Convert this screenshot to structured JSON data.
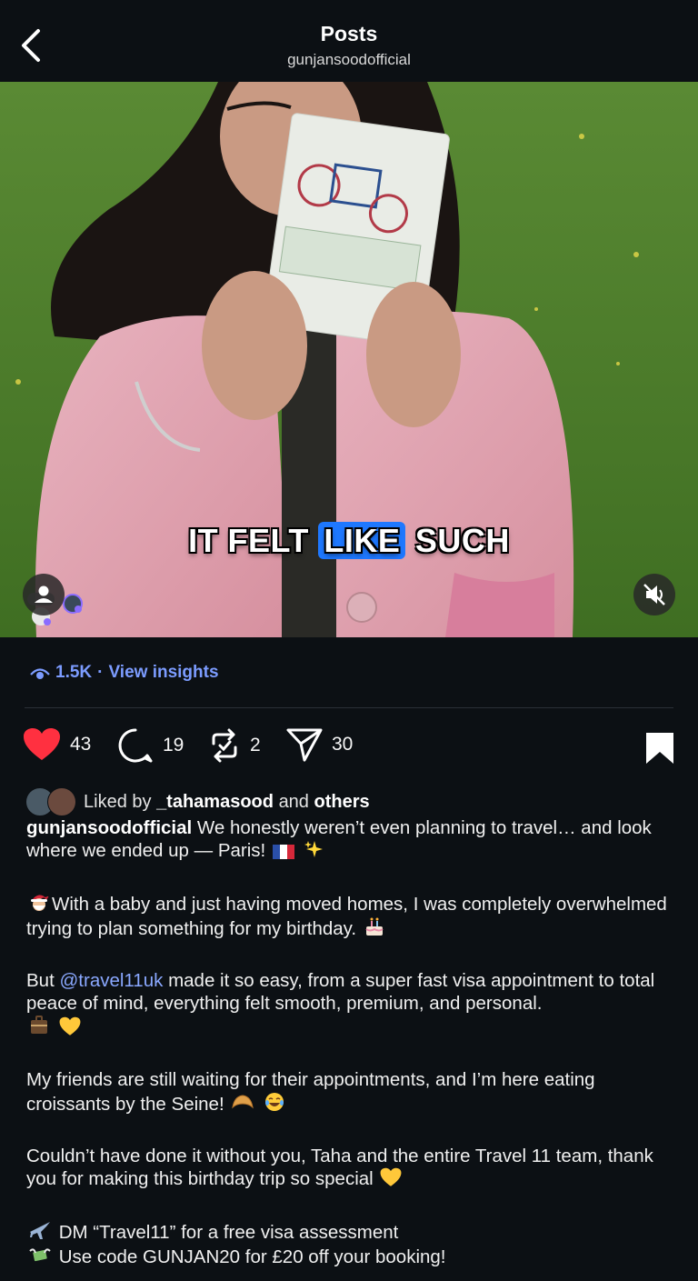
{
  "header": {
    "title": "Posts",
    "username": "gunjansoodofficial"
  },
  "media": {
    "overlay_caption_before": "IT FELT",
    "overlay_caption_highlight": "LIKE",
    "overlay_caption_after": "SUCH",
    "muted": true
  },
  "insights": {
    "views": "1.5K",
    "separator": "·",
    "link": "View insights"
  },
  "actions": {
    "likes": "43",
    "comments": "19",
    "reposts": "2",
    "shares": "30",
    "liked": true,
    "saved": true
  },
  "liked_by": {
    "prefix": "Liked by",
    "user": "_tahamasood",
    "middle": "and",
    "suffix": "others"
  },
  "caption": {
    "username": "gunjansoodofficial",
    "p1": "We honestly weren’t even planning to travel… and look where we ended up — Paris!",
    "p2": "With a baby and just having moved homes, I was completely overwhelmed trying to plan something for my birthday.",
    "p3_before": "But",
    "p3_mention": "@travel11uk",
    "p3_after": "made it so easy, from a super fast visa appointment to total peace of mind, everything felt smooth, premium, and personal.",
    "p4": "My friends are still waiting for their appointments, and I’m here eating croissants by the Seine!",
    "p5": "Couldn’t have done it without you, Taha and the entire Travel 11 team, thank you for making this birthday trip so special",
    "p6a": "DM “Travel11” for a free visa assessment",
    "p6b": "Use code GUNJAN20 for £20 off your booking!"
  },
  "colors": {
    "background": "#0c1014",
    "like_red": "#ff3040",
    "link_blue": "#7c9cff",
    "highlight_blue": "#1e78ff"
  },
  "icons": [
    "back-arrow-icon",
    "tag-people-icon",
    "muted-speaker-icon",
    "eye-icon",
    "heart-icon",
    "comment-icon",
    "repost-icon",
    "share-icon",
    "bookmark-icon"
  ]
}
